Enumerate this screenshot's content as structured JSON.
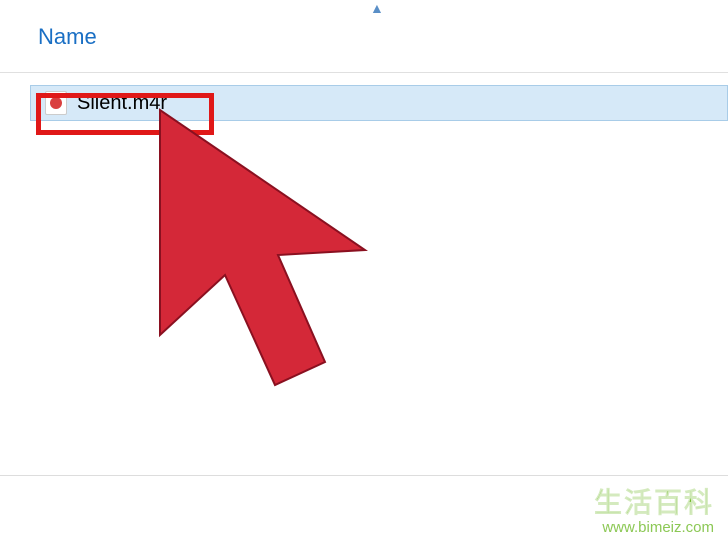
{
  "header": {
    "column_label": "Name"
  },
  "files": [
    {
      "name": "Silent.m4r",
      "icon_type": "m4r"
    }
  ],
  "watermark": {
    "cn_text": "生活百科",
    "url_text": "www.bimeiz.com"
  }
}
